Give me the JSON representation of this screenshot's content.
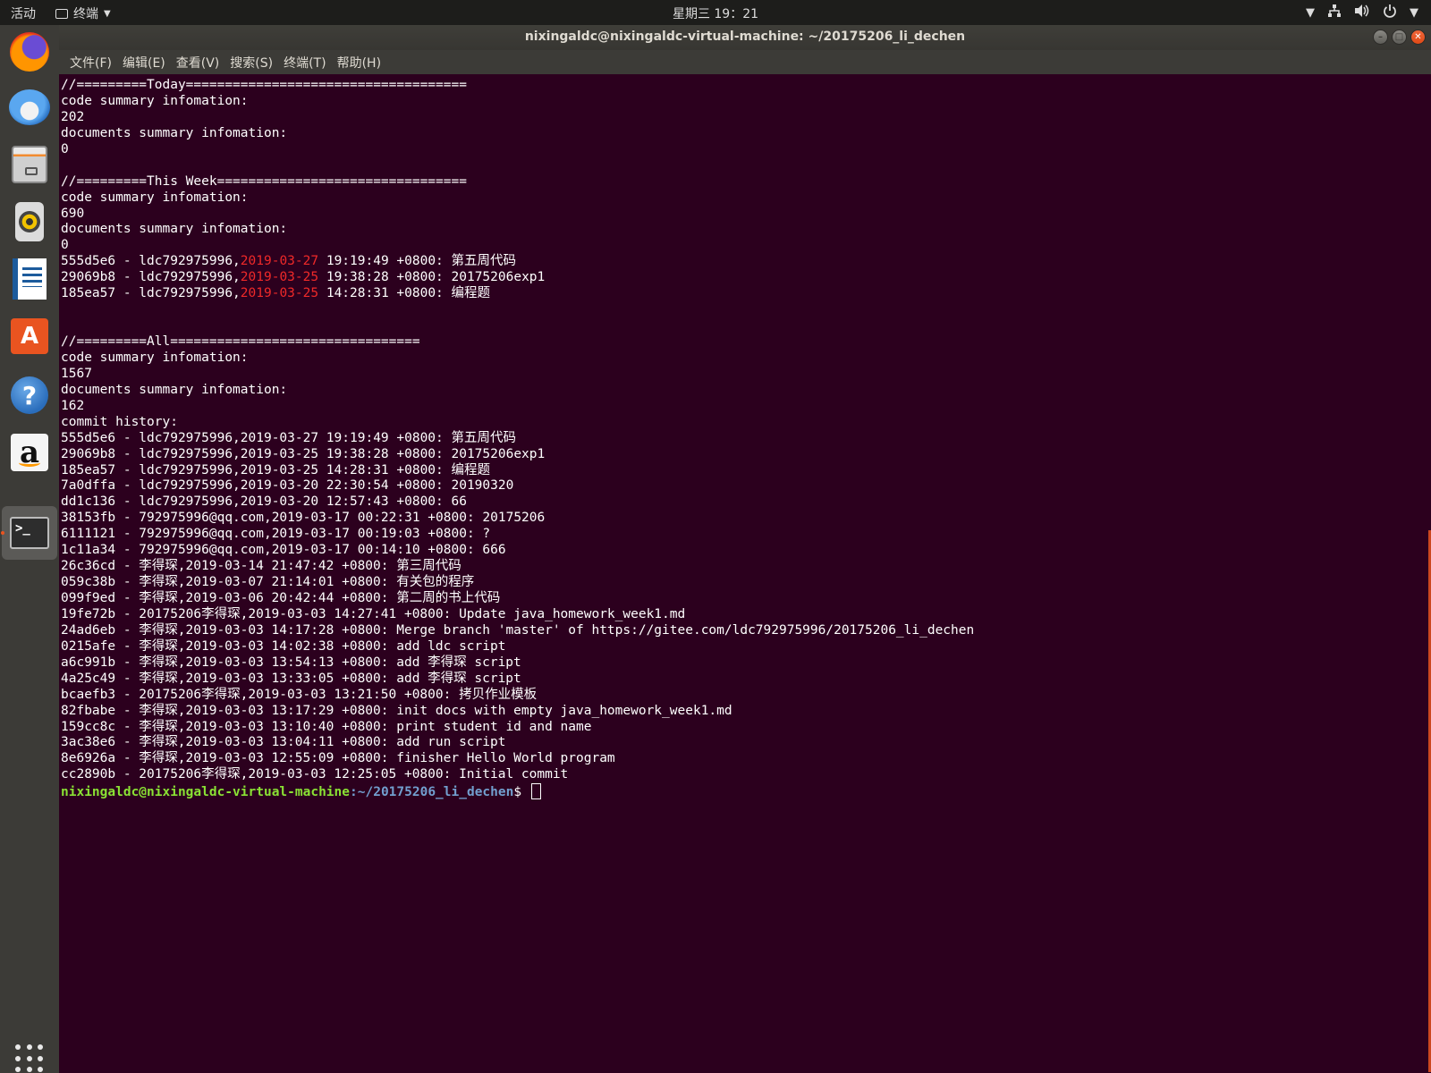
{
  "top_panel": {
    "activities": "活动",
    "app_name": "终端",
    "clock": "星期三 19：21"
  },
  "window": {
    "title": "nixingaldc@nixingaldc-virtual-machine: ~/20175206_li_dechen",
    "menu": [
      "文件(F)",
      "编辑(E)",
      "查看(V)",
      "搜索(S)",
      "终端(T)",
      "帮助(H)"
    ]
  },
  "dock": {
    "items": [
      "firefox-icon",
      "thunderbird-icon",
      "files-icon",
      "rhythmbox-icon",
      "libreoffice-writer-icon",
      "ubuntu-software-icon",
      "help-icon",
      "amazon-icon",
      "terminal-icon"
    ],
    "show_apps": "show-applications-icon"
  },
  "colors": {
    "terminal_bg": "#2c001e",
    "date_highlight": "#ef2929",
    "prompt_user": "#8ae234",
    "prompt_path": "#729fcf",
    "accent": "#e95420"
  },
  "terminal": {
    "lines": [
      {
        "text": "//=========Today===================================="
      },
      {
        "text": "code summary infomation:"
      },
      {
        "text": "202"
      },
      {
        "text": "documents summary infomation:"
      },
      {
        "text": "0"
      },
      {
        "text": ""
      },
      {
        "text": "//=========This Week================================"
      },
      {
        "text": "code summary infomation:"
      },
      {
        "text": "690"
      },
      {
        "text": "documents summary infomation:"
      },
      {
        "text": "0"
      },
      {
        "pre": "555d5e6 - ldc792975996,",
        "hl": "2019-03-27",
        "post": " 19:19:49 +0800: 第五周代码"
      },
      {
        "pre": "29069b8 - ldc792975996,",
        "hl": "2019-03-25",
        "post": " 19:38:28 +0800: 20175206exp1"
      },
      {
        "pre": "185ea57 - ldc792975996,",
        "hl": "2019-03-25",
        "post": " 14:28:31 +0800: 编程题"
      },
      {
        "text": ""
      },
      {
        "text": ""
      },
      {
        "text": "//=========All================================"
      },
      {
        "text": "code summary infomation:"
      },
      {
        "text": "1567"
      },
      {
        "text": "documents summary infomation:"
      },
      {
        "text": "162"
      },
      {
        "text": "commit history:"
      },
      {
        "text": "555d5e6 - ldc792975996,2019-03-27 19:19:49 +0800: 第五周代码"
      },
      {
        "text": "29069b8 - ldc792975996,2019-03-25 19:38:28 +0800: 20175206exp1"
      },
      {
        "text": "185ea57 - ldc792975996,2019-03-25 14:28:31 +0800: 编程题"
      },
      {
        "text": "7a0dffa - ldc792975996,2019-03-20 22:30:54 +0800: 20190320"
      },
      {
        "text": "dd1c136 - ldc792975996,2019-03-20 12:57:43 +0800: 66"
      },
      {
        "text": "38153fb - 792975996@qq.com,2019-03-17 00:22:31 +0800: 20175206"
      },
      {
        "text": "6111121 - 792975996@qq.com,2019-03-17 00:19:03 +0800: ?"
      },
      {
        "text": "1c11a34 - 792975996@qq.com,2019-03-17 00:14:10 +0800: 666"
      },
      {
        "text": "26c36cd - 李得琛,2019-03-14 21:47:42 +0800: 第三周代码"
      },
      {
        "text": "059c38b - 李得琛,2019-03-07 21:14:01 +0800: 有关包的程序"
      },
      {
        "text": "099f9ed - 李得琛,2019-03-06 20:42:44 +0800: 第二周的书上代码"
      },
      {
        "text": "19fe72b - 20175206李得琛,2019-03-03 14:27:41 +0800: Update java_homework_week1.md"
      },
      {
        "text": "24ad6eb - 李得琛,2019-03-03 14:17:28 +0800: Merge branch 'master' of https://gitee.com/ldc792975996/20175206_li_dechen"
      },
      {
        "text": "0215afe - 李得琛,2019-03-03 14:02:38 +0800: add ldc script"
      },
      {
        "text": "a6c991b - 李得琛,2019-03-03 13:54:13 +0800: add 李得琛 script"
      },
      {
        "text": "4a25c49 - 李得琛,2019-03-03 13:33:05 +0800: add 李得琛 script"
      },
      {
        "text": "bcaefb3 - 20175206李得琛,2019-03-03 13:21:50 +0800: 拷贝作业模板"
      },
      {
        "text": "82fbabe - 李得琛,2019-03-03 13:17:29 +0800: init docs with empty java_homework_week1.md"
      },
      {
        "text": "159cc8c - 李得琛,2019-03-03 13:10:40 +0800: print student id and name"
      },
      {
        "text": "3ac38e6 - 李得琛,2019-03-03 13:04:11 +0800: add run script"
      },
      {
        "text": "8e6926a - 李得琛,2019-03-03 12:55:09 +0800: finisher Hello World program"
      },
      {
        "text": "cc2890b - 20175206李得琛,2019-03-03 12:25:05 +0800: Initial commit"
      }
    ],
    "prompt": {
      "user_host": "nixingaldc@nixingaldc-virtual-machine",
      "sep": ":",
      "path": "~/20175206_li_dechen",
      "symbol": "$ "
    }
  }
}
